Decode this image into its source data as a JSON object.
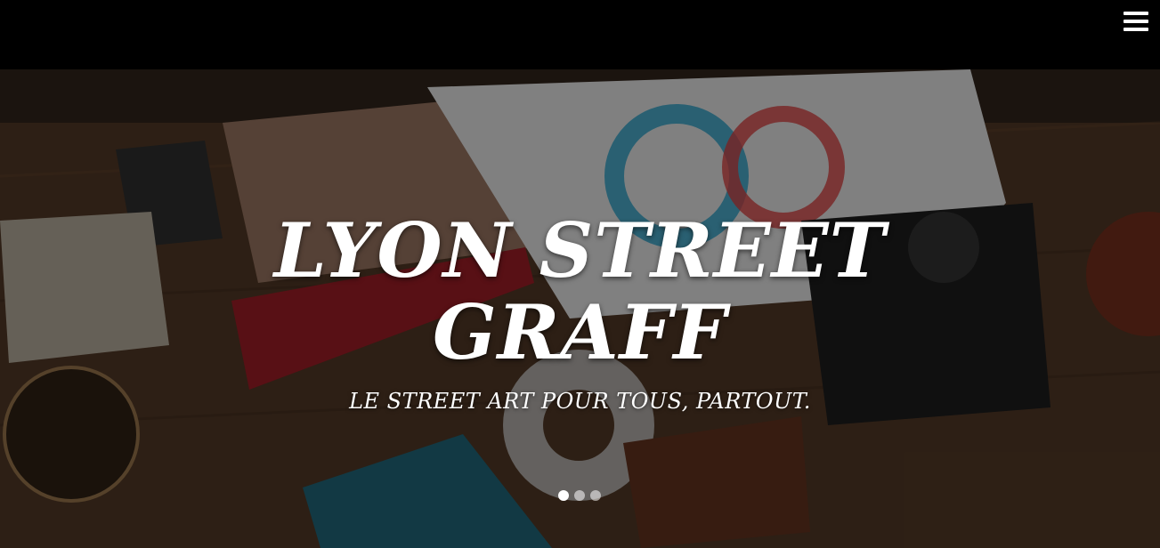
{
  "header": {
    "menu_icon": "hamburger-menu-icon"
  },
  "hero": {
    "title": "LYON STREET GRAFF",
    "subtitle": "LE STREET ART POUR TOUS, PARTOUT.",
    "background_image": "desk-flatlay-photo",
    "slides": [
      {
        "active": true
      },
      {
        "active": false
      },
      {
        "active": false
      }
    ]
  },
  "colors": {
    "topbar": "#000000",
    "text": "#ffffff",
    "overlay": "rgba(0,0,0,0.38)"
  }
}
